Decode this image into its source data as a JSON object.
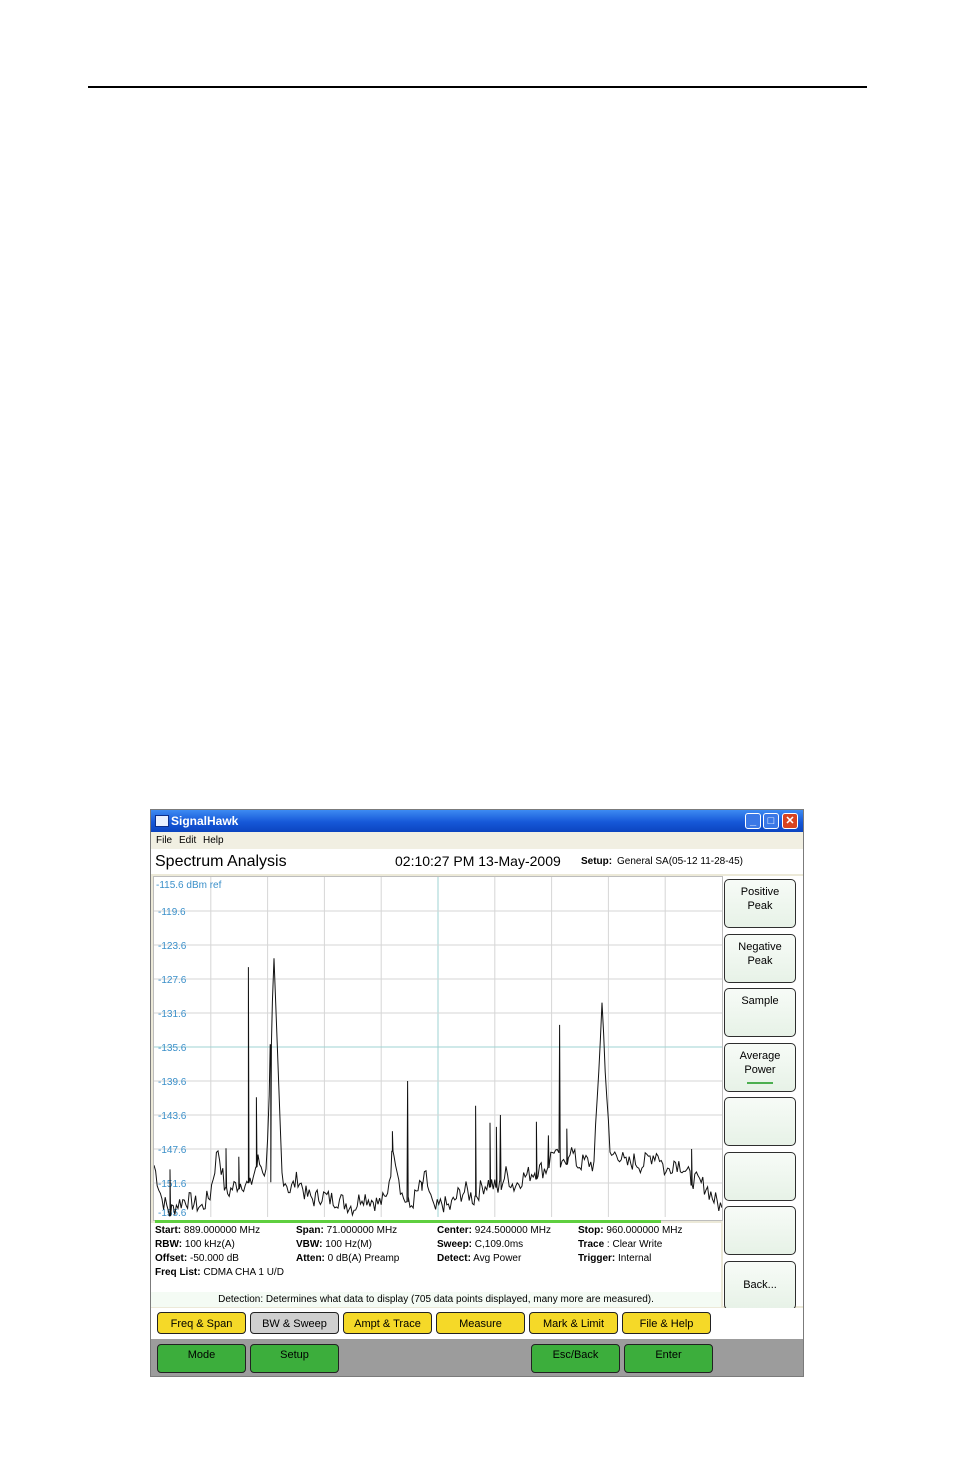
{
  "window": {
    "title": "SignalHawk"
  },
  "menu": [
    "File",
    "Edit",
    "Help"
  ],
  "header": {
    "title": "Spectrum Analysis",
    "datetime": "02:10:27 PM 13-May-2009",
    "setup_label": "Setup:",
    "setup_value": "General SA(05-12 11-28-45)"
  },
  "chart_data": {
    "type": "line",
    "ref_label": "-115.6 dBm ref",
    "y_ticks": [
      "-119.6",
      "-123.6",
      "-127.6",
      "-131.6",
      "-135.6",
      "-139.6",
      "-143.6",
      "-147.6",
      "-151.6",
      "-155.6"
    ],
    "ylim": [
      -155.6,
      -115.6
    ],
    "xlim": [
      889,
      960
    ],
    "x": [
      889,
      890,
      891,
      892,
      893,
      894,
      895,
      896,
      897,
      898,
      899,
      900,
      901,
      902,
      903,
      904,
      905,
      906,
      907,
      908,
      909,
      910,
      911,
      912,
      913,
      914,
      915,
      916,
      917,
      918,
      919,
      920,
      921,
      922,
      923,
      924,
      925,
      926,
      927,
      928,
      929,
      930,
      931,
      932,
      933,
      934,
      935,
      936,
      937,
      938,
      939,
      940,
      941,
      942,
      943,
      944,
      945,
      946,
      947,
      948,
      949,
      950,
      951,
      952,
      953,
      954,
      955,
      956,
      957,
      958,
      959,
      960
    ],
    "y": [
      -149.5,
      -153.5,
      -155.0,
      -154.0,
      -153.5,
      -154.0,
      -154.5,
      -153.0,
      -147.5,
      -153.0,
      -152.0,
      -151.5,
      -152.0,
      -149.0,
      -150.5,
      -126.2,
      -150.5,
      -152.5,
      -151.0,
      -153.0,
      -153.5,
      -153.0,
      -153.5,
      -153.5,
      -154.0,
      -154.5,
      -153.0,
      -153.5,
      -154.0,
      -153.5,
      -147.5,
      -153.0,
      -154.5,
      -152.5,
      -151.0,
      -155.0,
      -154.0,
      -154.5,
      -153.0,
      -152.5,
      -153.5,
      -152.0,
      -151.5,
      -152.5,
      -150.5,
      -152.0,
      -151.0,
      -150.5,
      -150.0,
      -150.0,
      -147.5,
      -150.0,
      -147.5,
      -149.5,
      -149.0,
      -149.5,
      -130.5,
      -148.5,
      -148.0,
      -149.5,
      -149.0,
      -149.5,
      -148.5,
      -148.0,
      -150.5,
      -149.0,
      -149.5,
      -151.0,
      -151.5,
      -152.0,
      -153.5,
      -154.5
    ],
    "peaks": [
      [
        891,
        -150.0
      ],
      [
        898,
        -147.5
      ],
      [
        899.6,
        -148.5
      ],
      [
        900.8,
        -126.2
      ],
      [
        901.8,
        -141.5
      ],
      [
        903.6,
        -151.5
      ],
      [
        918.8,
        -145.5
      ],
      [
        920.7,
        -139.6
      ],
      [
        922.5,
        -152.5
      ],
      [
        929.2,
        -142.5
      ],
      [
        931.0,
        -144.5
      ],
      [
        931.8,
        -145.0
      ],
      [
        932.3,
        -143.6
      ],
      [
        936.8,
        -144.4
      ],
      [
        938.3,
        -146.0
      ],
      [
        939.7,
        -133.0
      ],
      [
        940.6,
        -145.2
      ],
      [
        956.2,
        -147.6
      ]
    ],
    "grid": true
  },
  "info": {
    "start_label": "Start:",
    "start": "889.000000 MHz",
    "span_label": "Span:",
    "span": "71.000000 MHz",
    "center_label": "Center:",
    "center": "924.500000 MHz",
    "stop_label": "Stop:",
    "stop": "960.000000 MHz",
    "rbw_label": "RBW:",
    "rbw": "100 kHz(A)",
    "vbw_label": "VBW:",
    "vbw": "100 Hz(M)",
    "sweep_label": "Sweep:",
    "sweep": "C,109.0ms",
    "trace_label": "Trace",
    "trace": ": Clear Write",
    "offset_label": "Offset:",
    "offset": "-50.000 dB",
    "atten_label": "Atten:",
    "atten": "0 dB(A) Preamp",
    "detect_label": "Detect:",
    "detect": "Avg Power",
    "trigger_label": "Trigger:",
    "trigger": "Internal",
    "freqlist_label": "Freq List:",
    "freqlist": "CDMA CHA 1 U/D"
  },
  "status_text": "Detection: Determines what data to display (705 data points displayed, many more are measured).",
  "side_buttons": [
    {
      "line1": "Positive",
      "line2": "Peak"
    },
    {
      "line1": "Negative",
      "line2": "Peak"
    },
    {
      "line1": "Sample",
      "line2": ""
    },
    {
      "line1": "Average",
      "line2": "Power"
    },
    {
      "line1": "",
      "line2": ""
    },
    {
      "line1": "",
      "line2": ""
    },
    {
      "line1": "",
      "line2": ""
    },
    {
      "line1": "Back...",
      "line2": ""
    }
  ],
  "tabs": [
    "Freq & Span",
    "BW & Sweep",
    "Ampt & Trace",
    "Measure",
    "Mark & Limit",
    "File & Help"
  ],
  "bottom_buttons": [
    "Mode",
    "Setup",
    "Esc/Back",
    "Enter"
  ],
  "colors": {
    "tab": "#f5d928",
    "tab_selected": "#cfcfcf",
    "action": "#3cae3c",
    "tick_label": "#3a8fc9"
  }
}
